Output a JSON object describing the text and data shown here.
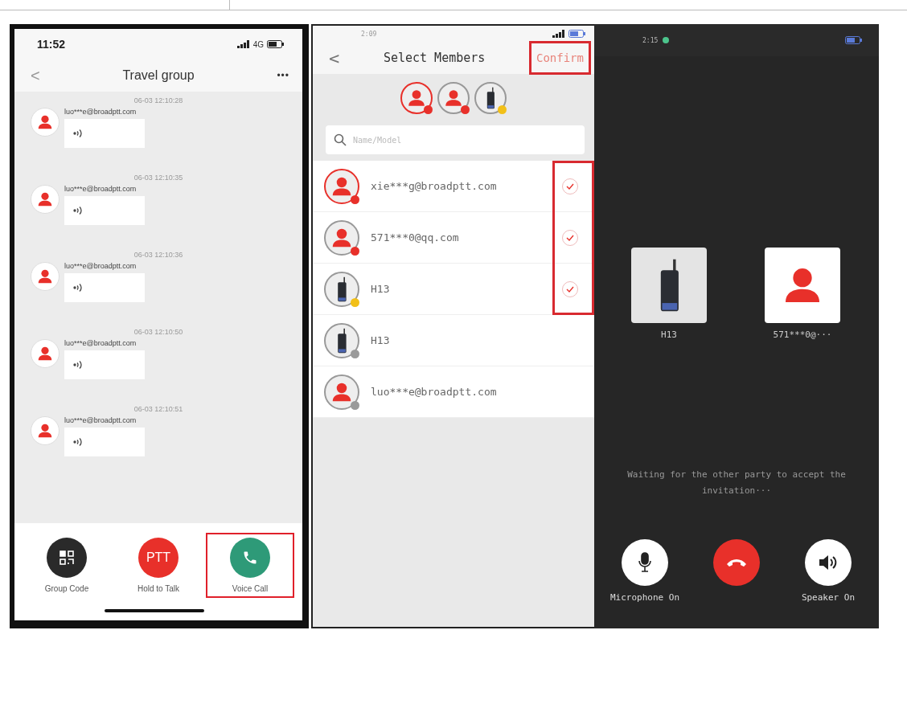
{
  "chat_screen": {
    "status_bar": {
      "time": "11:52",
      "network": "4G"
    },
    "title": "Travel group",
    "back": "<",
    "more": "•••",
    "messages": [
      {
        "time": "06-03 12:10:28",
        "sender": "luo***e@broadptt.com"
      },
      {
        "time": "06-03 12:10:35",
        "sender": "luo***e@broadptt.com"
      },
      {
        "time": "06-03 12:10:36",
        "sender": "luo***e@broadptt.com"
      },
      {
        "time": "06-03 12:10:50",
        "sender": "luo***e@broadptt.com"
      },
      {
        "time": "06-03 12:10:51",
        "sender": "luo***e@broadptt.com"
      }
    ],
    "actions": [
      {
        "kind": "qr",
        "label": "Group Code",
        "highlighted": false
      },
      {
        "kind": "ptt",
        "icon_text": "PTT",
        "label": "Hold to Talk",
        "highlighted": false
      },
      {
        "kind": "call",
        "label": "Voice Call",
        "highlighted": true
      }
    ]
  },
  "select_screen": {
    "status_bar": {
      "time": "2:09"
    },
    "back": "<",
    "title": "Select Members",
    "confirm": {
      "label": "Confirm",
      "highlighted": true
    },
    "selected_avatars": [
      {
        "kind": "person",
        "color": "#e8302a",
        "active": true
      },
      {
        "kind": "person",
        "color": "#e8302a",
        "active": false
      },
      {
        "kind": "radio",
        "color": "#f2c018",
        "active": false
      }
    ],
    "search": {
      "placeholder": "Name/Model"
    },
    "checks_highlighted": true,
    "members": [
      {
        "kind": "person",
        "name": "xie***g@broadptt.com",
        "color": "#e8302a",
        "active": true,
        "checked": true
      },
      {
        "kind": "person",
        "name": "571***0@qq.com",
        "color": "#e8302a",
        "active": false,
        "checked": true
      },
      {
        "kind": "radio",
        "name": "H13",
        "color": "#f2c018",
        "active": false,
        "checked": true
      },
      {
        "kind": "radio",
        "name": "H13",
        "color": "#9a9a9a",
        "active": false,
        "checked": false
      },
      {
        "kind": "person",
        "name": "luo***e@broadptt.com",
        "color": "#9a9a9a",
        "active": false,
        "checked": false
      }
    ]
  },
  "call_screen": {
    "status_bar": {
      "time": "2:15"
    },
    "participants": [
      {
        "kind": "radio",
        "name": "H13"
      },
      {
        "kind": "person",
        "name": "571***0@···"
      }
    ],
    "status": "Waiting for the other party to accept the invitation···",
    "controls": [
      {
        "kind": "mic",
        "label": "Microphone On"
      },
      {
        "kind": "hangup"
      },
      {
        "kind": "speaker",
        "label": "Speaker On"
      }
    ]
  }
}
